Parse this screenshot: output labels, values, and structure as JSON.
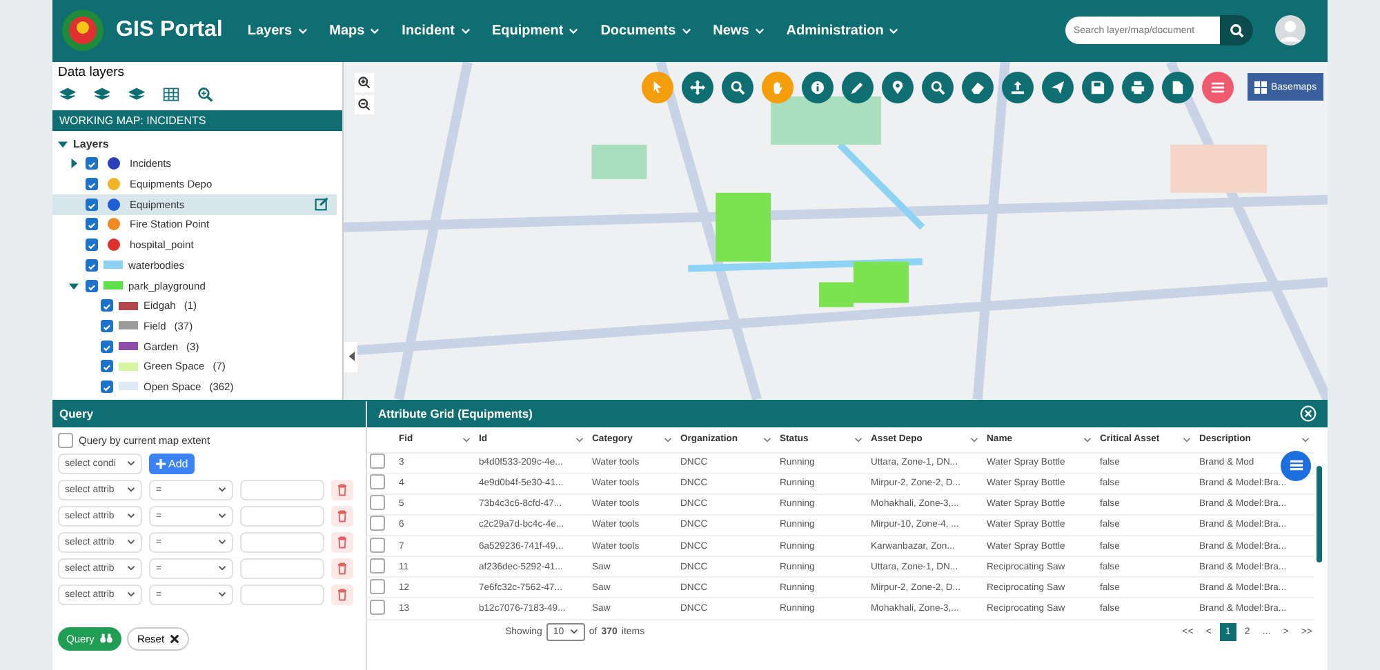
{
  "header": {
    "title": "GIS Portal",
    "menu": [
      "Layers",
      "Maps",
      "Incident",
      "Equipment",
      "Documents",
      "News",
      "Administration"
    ],
    "search": {
      "placeholder": "Search layer/map/document"
    }
  },
  "data_layers": {
    "title": "Data layers",
    "working_map": "WORKING MAP: INCIDENTS",
    "root": {
      "label": "Layers",
      "expanded": true,
      "children": [
        {
          "label": "Incidents",
          "kind": "point",
          "color": "#2a3fb8",
          "checked": true,
          "selected": false,
          "expanded": false
        },
        {
          "label": "Equipments Depo",
          "kind": "point",
          "color": "#f0b429",
          "checked": true,
          "selected": false
        },
        {
          "label": "Equipments",
          "kind": "point",
          "color": "#1f5fd6",
          "checked": true,
          "selected": true
        },
        {
          "label": "Fire Station Point",
          "kind": "point",
          "color": "#f08a24",
          "checked": true,
          "selected": false
        },
        {
          "label": "hospital_point",
          "kind": "point",
          "color": "#e03131",
          "checked": true,
          "selected": false
        },
        {
          "label": "waterbodies",
          "kind": "fill",
          "color": "#8fd3f4",
          "checked": true,
          "selected": false
        },
        {
          "label": "park_playground",
          "kind": "fill",
          "color": "#5ee04a",
          "checked": true,
          "selected": false,
          "expanded": true,
          "children": [
            {
              "label": "Eidgah",
              "count": "(1)",
              "kind": "fill",
              "color": "#b0474a",
              "checked": true,
              "selected": false
            },
            {
              "label": "Field",
              "count": "(37)",
              "kind": "fill",
              "color": "#9a9a9a",
              "checked": true,
              "selected": false
            },
            {
              "label": "Garden",
              "count": "(3)",
              "kind": "fill",
              "color": "#8e4da8",
              "checked": true,
              "selected": false
            },
            {
              "label": "Green Space",
              "count": "(7)",
              "kind": "fill",
              "color": "#d6f5a3",
              "checked": true,
              "selected": false
            },
            {
              "label": "Open Space",
              "count": "(362)",
              "kind": "fill",
              "color": "#dde9f5",
              "checked": true,
              "selected": false
            }
          ]
        }
      ]
    }
  },
  "map": {
    "tools": [
      {
        "kind": "pointer",
        "color": "#f59e0b"
      },
      {
        "kind": "move",
        "color": "#0e6e72"
      },
      {
        "kind": "zoom",
        "color": "#0e6e72"
      },
      {
        "kind": "hand",
        "color": "#f59e0b"
      },
      {
        "kind": "info",
        "color": "#0e6e72"
      },
      {
        "kind": "pencil",
        "color": "#0e6e72"
      },
      {
        "kind": "pin",
        "color": "#0e6e72"
      },
      {
        "kind": "zoom",
        "color": "#0e6e72"
      },
      {
        "kind": "eraser",
        "color": "#0e6e72"
      },
      {
        "kind": "upload",
        "color": "#0e6e72"
      },
      {
        "kind": "plane",
        "color": "#0e6e72"
      },
      {
        "kind": "save",
        "color": "#0e6e72"
      },
      {
        "kind": "print",
        "color": "#0e6e72"
      },
      {
        "kind": "file",
        "color": "#0e6e72"
      },
      {
        "kind": "menu",
        "color": "#ef5a6f"
      }
    ],
    "basemaps": "Basemaps"
  },
  "query": {
    "title": "Query",
    "extent": {
      "label": "Query by current map extent",
      "checked": false
    },
    "condition": {
      "placeholder": "select condi"
    },
    "add": "Add",
    "conditions": [
      {
        "attribute": "select attrib",
        "operator": "="
      },
      {
        "attribute": "select attrib",
        "operator": "="
      },
      {
        "attribute": "select attrib",
        "operator": "="
      },
      {
        "attribute": "select attrib",
        "operator": "="
      },
      {
        "attribute": "select attrib",
        "operator": "="
      }
    ],
    "buttons": [
      "Query",
      "Reset"
    ]
  },
  "grid": {
    "title": "Attribute Grid (Equipments)",
    "columns": [
      "Fid",
      "Id",
      "Category",
      "Organization",
      "Status",
      "Asset Depo",
      "Name",
      "Critical Asset",
      "Description"
    ],
    "rows": [
      {
        "cells": [
          "3",
          "b4d0f533-209c-4e...",
          "Water tools",
          "DNCC",
          "Running",
          "Uttara, Zone-1, DN...",
          "Water Spray Bottle",
          "false",
          "Brand & Mod"
        ],
        "checked": false
      },
      {
        "cells": [
          "4",
          "4e9d0b4f-5e30-41...",
          "Water tools",
          "DNCC",
          "Running",
          "Mirpur-2, Zone-2, D...",
          "Water Spray Bottle",
          "false",
          "Brand & Model:Bra..."
        ],
        "checked": false
      },
      {
        "cells": [
          "5",
          "73b4c3c6-8cfd-47...",
          "Water tools",
          "DNCC",
          "Running",
          "Mohakhali, Zone-3,...",
          "Water Spray Bottle",
          "false",
          "Brand & Model:Bra..."
        ],
        "checked": false
      },
      {
        "cells": [
          "6",
          "c2c29a7d-bc4c-4e...",
          "Water tools",
          "DNCC",
          "Running",
          "Mirpur-10, Zone-4, ...",
          "Water Spray Bottle",
          "false",
          "Brand & Model:Bra..."
        ],
        "checked": false
      },
      {
        "cells": [
          "7",
          "6a529236-741f-49...",
          "Water tools",
          "DNCC",
          "Running",
          "Karwanbazar, Zon...",
          "Water Spray Bottle",
          "false",
          "Brand & Model:Bra..."
        ],
        "checked": false
      },
      {
        "cells": [
          "11",
          "af236dec-5292-41...",
          "Saw",
          "DNCC",
          "Running",
          "Uttara, Zone-1, DN...",
          "Reciprocating Saw",
          "false",
          "Brand & Model:Bra..."
        ],
        "checked": false
      },
      {
        "cells": [
          "12",
          "7e6fc32c-7562-47...",
          "Saw",
          "DNCC",
          "Running",
          "Mirpur-2, Zone-2, D...",
          "Reciprocating Saw",
          "false",
          "Brand & Model:Bra..."
        ],
        "checked": false
      },
      {
        "cells": [
          "13",
          "b12c7076-7183-49...",
          "Saw",
          "DNCC",
          "Running",
          "Mohakhali, Zone-3,...",
          "Reciprocating Saw",
          "false",
          "Brand & Model:Bra..."
        ],
        "checked": false
      }
    ],
    "showing": "Showing",
    "page_size": "10",
    "of": "of",
    "total": "370",
    "items": "items",
    "pages": [
      {
        "label": "<<",
        "selected": false
      },
      {
        "label": "<",
        "selected": false
      },
      {
        "label": "1",
        "selected": true
      },
      {
        "label": "2",
        "selected": false
      },
      {
        "label": "...",
        "selected": false
      },
      {
        "label": ">",
        "selected": false
      },
      {
        "label": ">>",
        "selected": false
      }
    ]
  }
}
